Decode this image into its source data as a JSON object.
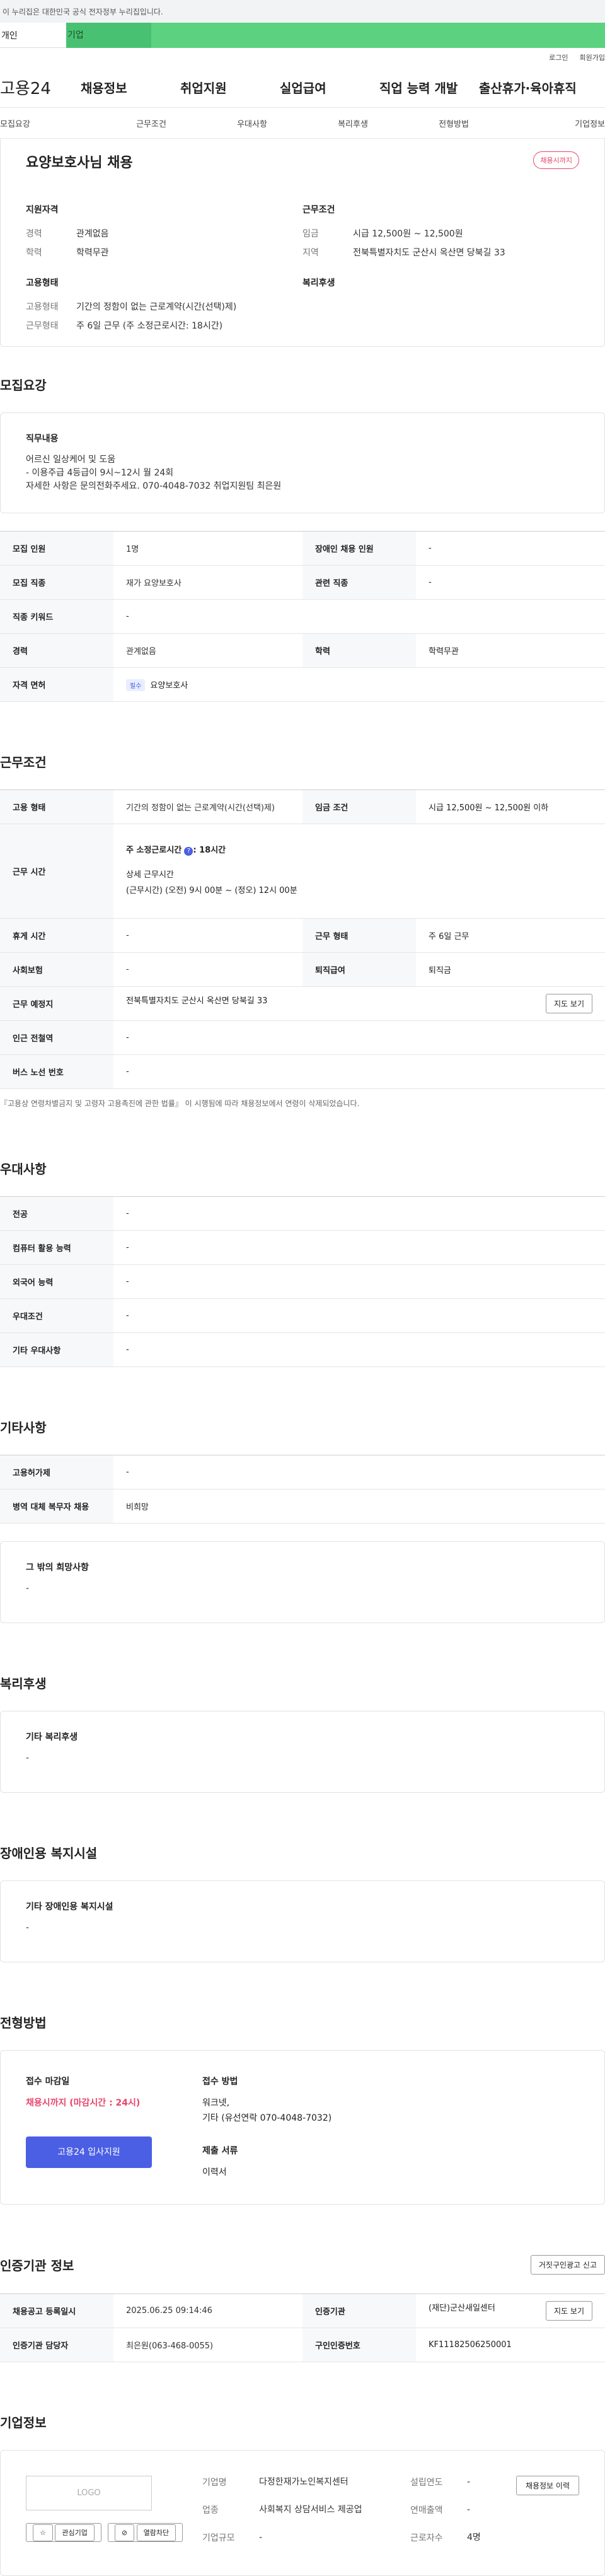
{
  "gov_notice": "이 누리집은 대한민국 공식 전자정부 누리집입니다.",
  "tabs": {
    "individual": "개인",
    "corporate": "기업"
  },
  "util": {
    "login": "로그인",
    "join": "회원가입"
  },
  "gnb": {
    "logo": "고용24",
    "menus": [
      "채용정보",
      "취업지원",
      "실업급여",
      "직업 능력 개발",
      "출산휴가·육아휴직"
    ]
  },
  "subnav": [
    "모집요강",
    "근무조건",
    "우대사항",
    "복리후생",
    "전형방법",
    "기업정보"
  ],
  "summary": {
    "title": "요양보호사님 채용",
    "badge": "채용시까지",
    "qual_title": "지원자격",
    "qual": [
      {
        "k": "경력",
        "v": "관계없음"
      },
      {
        "k": "학력",
        "v": "학력무관"
      }
    ],
    "cond_title": "근무조건",
    "cond": [
      {
        "k": "임금",
        "v": "시급 12,500원 ~ 12,500원"
      },
      {
        "k": "지역",
        "v": "전북특별자치도 군산시 옥산면 당북길 33"
      }
    ],
    "type_title": "고용형태",
    "type": [
      {
        "k": "고용형태",
        "v": "기간의 정함이 없는 근로계약(시간(선택)제)"
      },
      {
        "k": "근무형태",
        "v": "주 6일 근무 (주 소정근로시간: 18시간)"
      }
    ],
    "welfare_title": "복리후생"
  },
  "recruit": {
    "title": "모집요강",
    "duty_title": "직무내용",
    "duty_lines": [
      "어르신 일상케어 및 도움",
      "- 이용주급 4등급이 9시~12시 월 24회",
      "자세한 사항은 문의전화주세요. 070-4048-7032 취업지원팀 최은원"
    ],
    "rows": [
      [
        "모집 인원",
        "1명",
        "장애인 채용 인원",
        "-"
      ],
      [
        "모집 직종",
        "재가 요양보호사",
        "관련 직종",
        "-"
      ],
      [
        "직종 키워드",
        "-"
      ],
      [
        "경력",
        "관계없음",
        "학력",
        "학력무관"
      ],
      [
        "자격 면허",
        "요양보호사"
      ]
    ],
    "license_tag": "필수"
  },
  "work": {
    "title": "근무조건",
    "type_k": "고용 형태",
    "type_v": "기간의 정함이 없는 근로계약(시간(선택)제)",
    "wage_k": "임금 조건",
    "wage_v": "시급 12,500원 ~ 12,500원 이하",
    "time_k": "근무 시간",
    "time_main": "주 소정근로시간",
    "time_hours": ": 18시간",
    "time_detail_title": "상세 근무시간",
    "time_detail": "(근무시간) (오전) 9시 00분 ~ (정오) 12시 00분",
    "rows": [
      [
        "휴게 시간",
        "-",
        "근무 형태",
        "주 6일 근무"
      ],
      [
        "사회보험",
        "-",
        "퇴직급여",
        "퇴직금"
      ]
    ],
    "place_k": "근무 예정지",
    "place_v": "전북특별자치도 군산시 옥산면 당북길 33",
    "map_btn": "지도 보기",
    "subway_k": "인근 전철역",
    "subway_v": "-",
    "bus_k": "버스 노선 번호",
    "bus_v": "-",
    "note": "『고용상 연령차별금지 및 고령자 고용촉진에 관한 법률』 이 시행됨에 따라 채용정보에서 연령이 삭제되었습니다."
  },
  "pref": {
    "title": "우대사항",
    "rows": [
      [
        "전공",
        "-"
      ],
      [
        "컴퓨터 활용 능력",
        "-"
      ],
      [
        "외국어 능력",
        "-"
      ],
      [
        "우대조건",
        "-"
      ],
      [
        "기타 우대사항",
        "-"
      ]
    ]
  },
  "etc": {
    "title": "기타사항",
    "rows": [
      [
        "고용허가제",
        "-"
      ],
      [
        "병역 대체 복무자 채용",
        "비희망"
      ]
    ],
    "hope_title": "그 밖의 희망사항",
    "hope_v": "-"
  },
  "welfare": {
    "title": "복리후생",
    "box_title": "기타 복리후생",
    "box_v": "-"
  },
  "disabled": {
    "title": "장애인용 복지시설",
    "box_title": "기타 장애인용 복지시설",
    "box_v": "-"
  },
  "selection": {
    "title": "전형방법",
    "deadline_k": "접수 마감일",
    "deadline_v": "채용시까지 (마감시간 : 24시)",
    "method_k": "접수 방법",
    "method_v1": "워크넷,",
    "method_v2": "기타 (유선연락 070-4048-7032)",
    "apply_btn": "고용24 입사지원",
    "docs_k": "제출 서류",
    "docs_v": "이력서"
  },
  "cert": {
    "title": "인증기관 정보",
    "report_btn": "거짓구인광고 신고",
    "rows": [
      [
        "채용공고 등록일시",
        "2025.06.25 09:14:46",
        "인증기관",
        "(재단)군산새일센터"
      ],
      [
        "인증기관 담당자",
        "최은원(063-468-0055)",
        "구인인증번호",
        "KF11182506250001"
      ]
    ],
    "map_btn": "지도 보기"
  },
  "company": {
    "title": "기업정보",
    "logo": "LOGO",
    "fav_btn": "관심기업",
    "block_btn": "열람차단",
    "history_btn": "채용정보 이력",
    "name_k": "기업명",
    "name_v": "다정한재가노인복지센터",
    "year_k": "설립연도",
    "year_v": "-",
    "sales_k": "연매출액",
    "sales_v": "-",
    "ind_k": "업종",
    "ind_v": "사회복지 상담서비스 제공업",
    "emp_k": "근로자수",
    "emp_v": "4명",
    "scale_k": "기업규모",
    "scale_v": "-"
  }
}
